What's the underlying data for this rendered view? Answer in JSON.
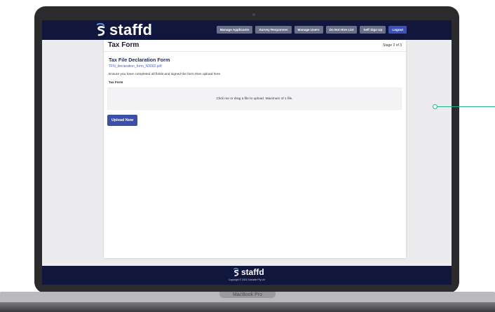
{
  "device": {
    "label": "MacBook Pro"
  },
  "header": {
    "brand": "staffd",
    "nav": [
      "Manage Applicants",
      "Survey Responses",
      "Manage Users",
      "Do Not Hire List",
      "Self Sign Up",
      "Logout"
    ]
  },
  "page": {
    "title": "Tax Form",
    "stage": "Stage 2 of 3"
  },
  "form": {
    "title": "Tax File Declaration Form",
    "file_link": "TFN_declaration_form_N3092.pdf",
    "instructions": "Ensure you have completed all fields and signed the form then upload here.",
    "field_label": "Tax Form",
    "dropzone_text": "Click me or drag a file to upload. Maximum of 1 file.",
    "upload_button": "Upload Now"
  },
  "footer": {
    "brand": "staffd",
    "copyright": "Copyright © 2021 Solvable Pty Ltd"
  },
  "colors": {
    "header_bg": "#11163d",
    "primary": "#3b4ea8",
    "accent_callout": "#1fb48a"
  }
}
